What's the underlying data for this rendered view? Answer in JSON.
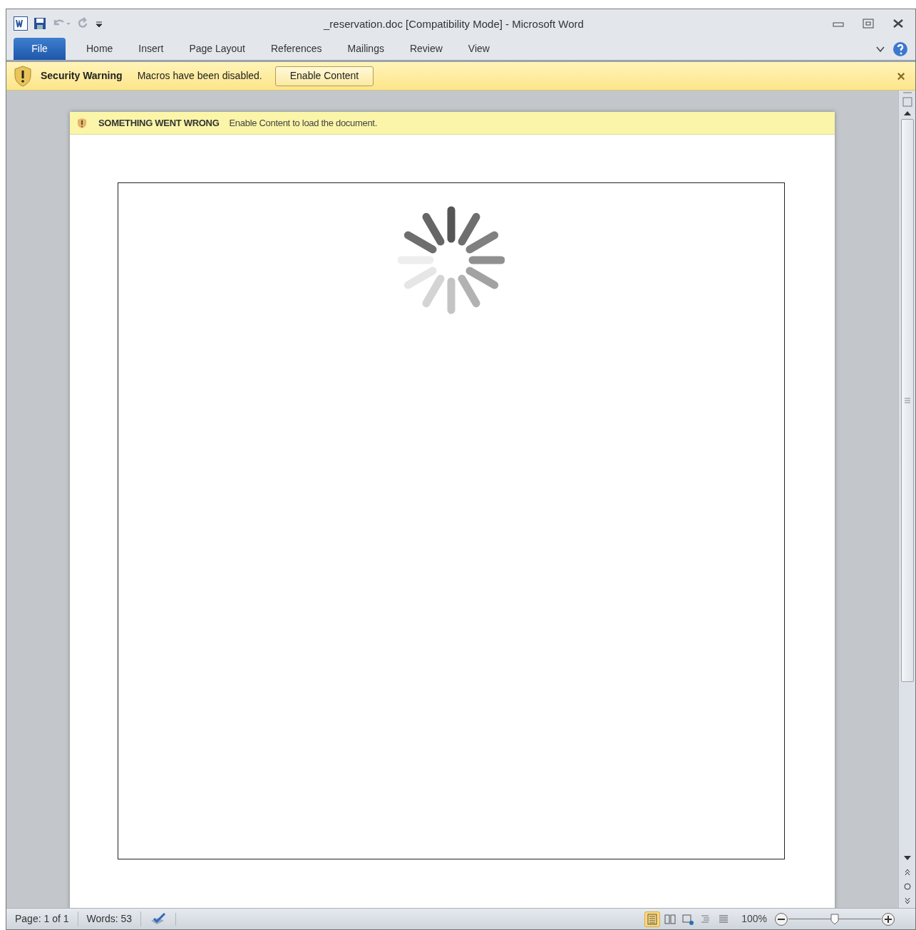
{
  "window": {
    "title": "_reservation.doc [Compatibility Mode]  -  Microsoft Word"
  },
  "tabs": [
    {
      "label": "File",
      "kind": "file"
    },
    {
      "label": "Home",
      "kind": "tab"
    },
    {
      "label": "Insert",
      "kind": "tab"
    },
    {
      "label": "Page Layout",
      "kind": "tab"
    },
    {
      "label": "References",
      "kind": "tab"
    },
    {
      "label": "Mailings",
      "kind": "tab"
    },
    {
      "label": "Review",
      "kind": "tab"
    },
    {
      "label": "View",
      "kind": "tab"
    }
  ],
  "security_bar": {
    "title": "Security Warning",
    "message": "Macros have been disabled.",
    "button": "Enable Content",
    "close": "×"
  },
  "document": {
    "banner_title": "SOMETHING WENT WRONG",
    "banner_message": "Enable Content to load the document."
  },
  "status_bar": {
    "page": "Page: 1 of 1",
    "words": "Words: 53",
    "views": [
      {
        "selected": true
      },
      {
        "selected": false
      },
      {
        "selected": false
      },
      {
        "selected": false
      },
      {
        "selected": false
      }
    ],
    "zoom": "100%",
    "zoom_slider": {
      "level": 0.5
    }
  }
}
